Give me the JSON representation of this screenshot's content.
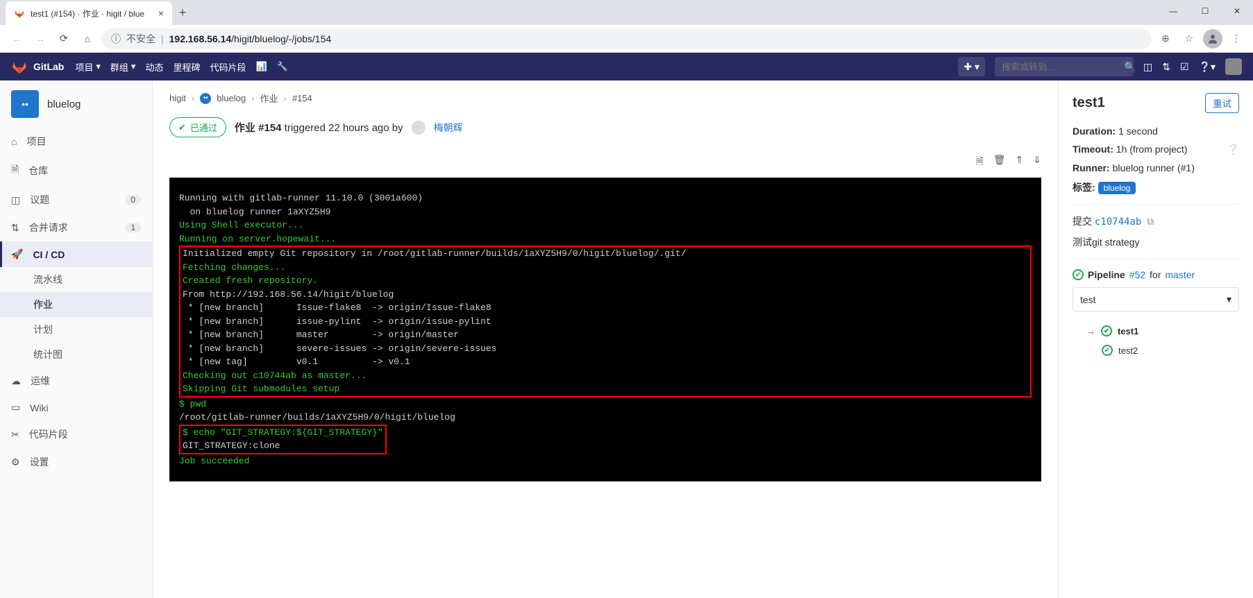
{
  "browser": {
    "tab_title": "test1 (#154) · 作业 · higit / blue",
    "url_insecure": "不安全",
    "url_host": "192.168.56.14",
    "url_path": "/higit/bluelog/-/jobs/154"
  },
  "gitlab_nav": {
    "brand": "GitLab",
    "menu": {
      "projects": "项目",
      "groups": "群组",
      "activity": "动态",
      "milestones": "里程碑",
      "snippets": "代码片段"
    },
    "search_placeholder": "搜索或转到…"
  },
  "sidebar": {
    "project": "bluelog",
    "items": {
      "project": "项目",
      "repo": "仓库",
      "issues": "议题",
      "issues_count": "0",
      "mr": "合并请求",
      "mr_count": "1",
      "cicd": "CI / CD",
      "ops": "运维",
      "wiki": "Wiki",
      "snippets": "代码片段",
      "settings": "设置"
    },
    "cicd_sub": {
      "pipelines": "流水线",
      "jobs": "作业",
      "schedules": "计划",
      "charts": "统计图"
    }
  },
  "breadcrumbs": {
    "group": "higit",
    "project": "bluelog",
    "section": "作业",
    "id": "#154"
  },
  "job_header": {
    "status": "已通过",
    "label_job": "作业",
    "job_id": "#154",
    "triggered_text": "triggered 22 hours ago by",
    "user": "梅朝辉"
  },
  "log": {
    "l1": "Running with gitlab-runner 11.10.0 (3001a600)",
    "l2": "  on bluelog runner 1aXYZ5H9",
    "l3": "Using Shell executor...",
    "l4": "Running on server.hopewait...",
    "l5": "Initialized empty Git repository in /root/gitlab-runner/builds/1aXYZ5H9/0/higit/bluelog/.git/",
    "l6": "Fetching changes...",
    "l7": "Created fresh repository.",
    "l8": "From http://192.168.56.14/higit/bluelog",
    "l9": " * [new branch]      Issue-flake8  -> origin/Issue-flake8",
    "l10": " * [new branch]      issue-pylint  -> origin/issue-pylint",
    "l11": " * [new branch]      master        -> origin/master",
    "l12": " * [new branch]      severe-issues -> origin/severe-issues",
    "l13": " * [new tag]         v0.1          -> v0.1",
    "l14": "Checking out c10744ab as master...",
    "l15": "Skipping Git submodules setup",
    "l16": "$ pwd",
    "l17": "/root/gitlab-runner/builds/1aXYZ5H9/0/higit/bluelog",
    "l18": "$ echo \"GIT_STRATEGY:${GIT_STRATEGY}\"",
    "l19": "GIT_STRATEGY:clone",
    "l20": "Job succeeded"
  },
  "rightbar": {
    "title": "test1",
    "retry": "重试",
    "duration_label": "Duration:",
    "duration_val": "1 second",
    "timeout_label": "Timeout:",
    "timeout_val": "1h (from project)",
    "runner_label": "Runner:",
    "runner_val": "bluelog runner (#1)",
    "tags_label": "标签:",
    "tag_val": "bluelog",
    "commit_label": "提交",
    "commit_sha": "c10744ab",
    "commit_msg": "测试git strategy",
    "pipeline_label": "Pipeline",
    "pipeline_id": "#52",
    "pipeline_for": "for",
    "pipeline_branch": "master",
    "stage": "test",
    "job1": "test1",
    "job2": "test2"
  }
}
